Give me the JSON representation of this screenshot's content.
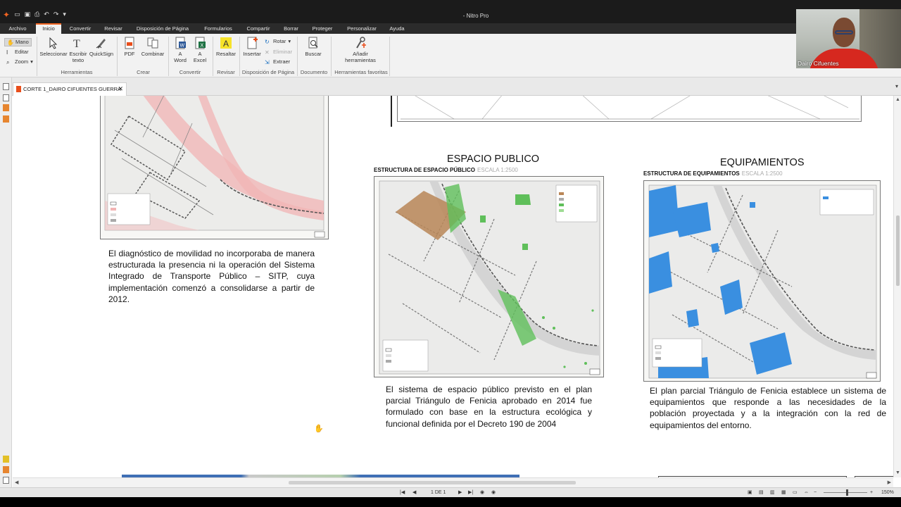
{
  "app": {
    "title": "- Nitro Pro",
    "quick_access": [
      "open-icon",
      "save-icon",
      "print-icon",
      "undo-icon",
      "redo-icon",
      "customize-icon"
    ]
  },
  "menu": {
    "tabs": [
      "Archivo",
      "Inicio",
      "Convertir",
      "Revisar",
      "Disposición de Página",
      "Formularios",
      "Compartir",
      "Borrar",
      "Proteger",
      "Personalizar",
      "Ayuda"
    ],
    "active": "Inicio"
  },
  "ribbon": {
    "tools": {
      "hand": "Mano",
      "edit": "Editar",
      "zoom": "Zoom"
    },
    "herramientas": {
      "select": "Seleccionar",
      "type_text": "Escribir texto",
      "quicksign": "QuickSign",
      "label": "Herramientas"
    },
    "crear": {
      "pdf": "PDF",
      "combine": "Combinar",
      "label": "Crear"
    },
    "convertir": {
      "word": "A Word",
      "excel": "A Excel",
      "label": "Convertir"
    },
    "revisar": {
      "highlight": "Resaltar",
      "label": "Revisar"
    },
    "disposicion": {
      "insert": "Insertar",
      "rotate": "Rotar",
      "delete": "Eliminar",
      "extract": "Extraer",
      "label": "Disposición de Página"
    },
    "documento": {
      "search": "Buscar",
      "label": "Documento"
    },
    "favoritas": {
      "add": "Añadir herramientas",
      "label": "Herramientas favoritas"
    }
  },
  "webcam": {
    "name": "Dairo Cifuentes"
  },
  "document": {
    "tab_title": "CORTE 1_DAIRO CIFUENTES GUERRA",
    "movilidad": {
      "paragraph": "El diagnóstico de movilidad no incorporaba de manera estructurada la presencia ni la operación del Sistema Integrado de Transporte Público – SITP, cuya implementación comenzó a consolidarse a partir de 2012."
    },
    "espacio_publico": {
      "heading": "ESPACIO PUBLICO",
      "subheading": "ESTRUCTURA DE ESPACIO PÚBLICO",
      "scale": "ESCALA 1:2500",
      "paragraph": "El sistema de espacio público previsto en el plan parcial Triángulo de Fenicia aprobado en 2014 fue formulado con base en la estructura ecológica y funcional definida por el Decreto 190 de 2004"
    },
    "equipamientos": {
      "heading": "EQUIPAMIENTOS",
      "subheading": "ESTRUCTURA DE EQUIPAMIENTOS",
      "scale": "ESCALA 1:2500",
      "paragraph": "El plan parcial Triángulo de Fenicia establece un sistema de equipamientos que responde a las necesidades de la población proyectada y a la integración con la red de equipamientos del entorno."
    }
  },
  "statusbar": {
    "page": "1 DE 1",
    "zoom": "150%"
  },
  "colors": {
    "accent": "#f26522",
    "equip_blue": "#3a8fe0",
    "green_space": "#5fbf5a",
    "road_pink": "#f0a9a9"
  }
}
